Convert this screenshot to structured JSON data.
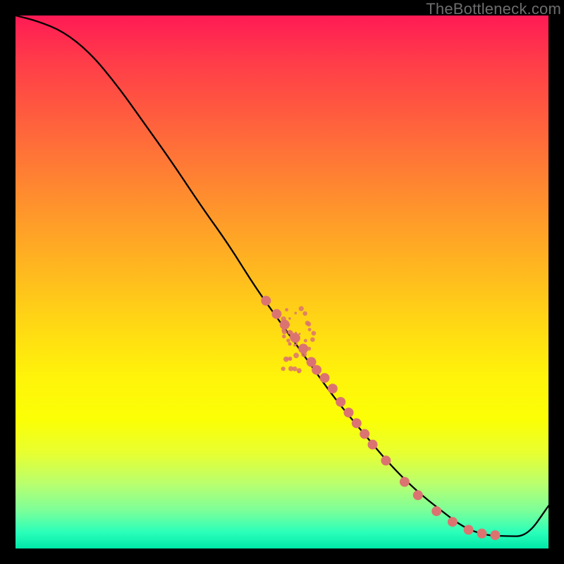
{
  "watermark": "TheBottleneck.com",
  "chart_data": {
    "type": "line",
    "title": "",
    "xlabel": "",
    "ylabel": "",
    "xlim": [
      0,
      100
    ],
    "ylim": [
      0,
      100
    ],
    "grid": false,
    "legend": false,
    "series": [
      {
        "name": "curve",
        "x": [
          0,
          4,
          9,
          14,
          19,
          24,
          29,
          35,
          40,
          45,
          50,
          55,
          60,
          65,
          70,
          75,
          80,
          84,
          88,
          92,
          96,
          100
        ],
        "y": [
          100,
          99,
          97,
          93,
          87,
          80,
          73,
          64,
          57,
          49,
          42,
          35,
          28,
          22,
          16,
          11,
          7,
          4,
          2.5,
          2.3,
          2.3,
          8
        ]
      }
    ],
    "points": [
      {
        "x": 47,
        "y": 46.5
      },
      {
        "x": 49,
        "y": 44
      },
      {
        "x": 50.5,
        "y": 42
      },
      {
        "x": 52.5,
        "y": 39.5
      },
      {
        "x": 54,
        "y": 37.5
      },
      {
        "x": 55.5,
        "y": 35
      },
      {
        "x": 56.5,
        "y": 33.5
      },
      {
        "x": 58,
        "y": 32
      },
      {
        "x": 59.5,
        "y": 30
      },
      {
        "x": 61,
        "y": 27.5
      },
      {
        "x": 62.5,
        "y": 25.5
      },
      {
        "x": 64,
        "y": 23.5
      },
      {
        "x": 65.5,
        "y": 21.5
      },
      {
        "x": 67,
        "y": 19.5
      },
      {
        "x": 69.5,
        "y": 16.5
      },
      {
        "x": 73,
        "y": 12.5
      },
      {
        "x": 75.5,
        "y": 10
      },
      {
        "x": 79,
        "y": 7
      },
      {
        "x": 82,
        "y": 5
      },
      {
        "x": 85,
        "y": 3.5
      },
      {
        "x": 87.5,
        "y": 2.8
      },
      {
        "x": 90,
        "y": 2.5
      }
    ],
    "noise_cluster": {
      "center": {
        "x": 53,
        "y": 39
      },
      "extent": {
        "dx": 3,
        "dy": 6
      }
    }
  }
}
